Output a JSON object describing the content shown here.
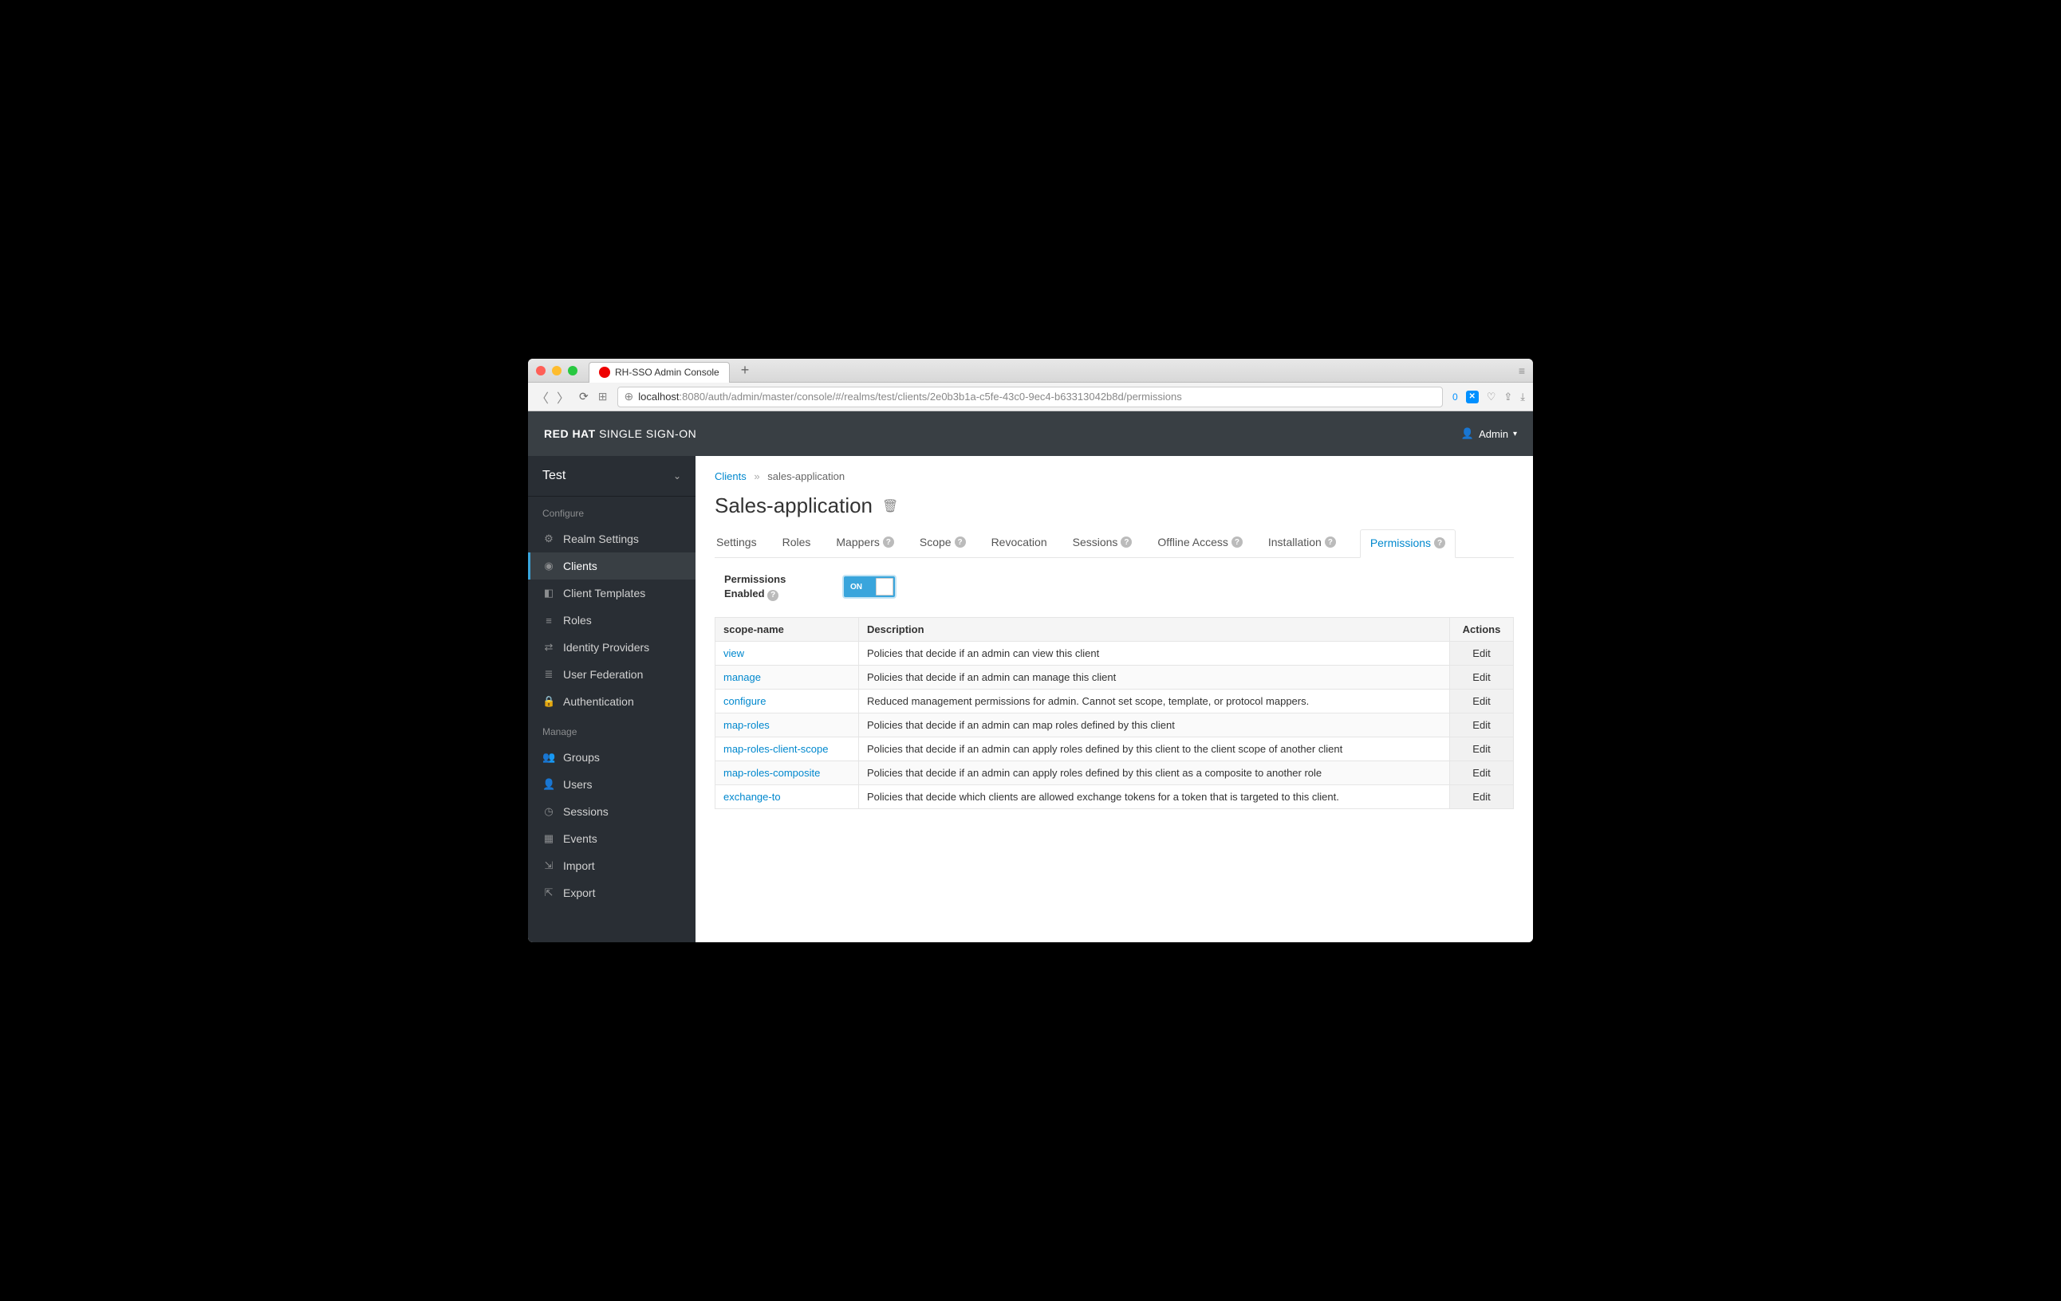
{
  "browser": {
    "tab_title": "RH-SSO Admin Console",
    "url_host": "localhost",
    "url_rest": ":8080/auth/admin/master/console/#/realms/test/clients/2e0b3b1a-c5fe-43c0-9ec4-b63313042b8d/permissions",
    "badge": "0"
  },
  "header": {
    "brand_strong": "RED HAT",
    "brand_rest": " SINGLE SIGN-ON",
    "user": "Admin"
  },
  "sidebar": {
    "realm": "Test",
    "section_configure": "Configure",
    "section_manage": "Manage",
    "configure": [
      {
        "label": "Realm Settings",
        "icon": "⚙"
      },
      {
        "label": "Clients",
        "icon": "◉"
      },
      {
        "label": "Client Templates",
        "icon": "◧"
      },
      {
        "label": "Roles",
        "icon": "≡"
      },
      {
        "label": "Identity Providers",
        "icon": "⇄"
      },
      {
        "label": "User Federation",
        "icon": "≣"
      },
      {
        "label": "Authentication",
        "icon": "🔒"
      }
    ],
    "manage": [
      {
        "label": "Groups",
        "icon": "👥"
      },
      {
        "label": "Users",
        "icon": "👤"
      },
      {
        "label": "Sessions",
        "icon": "◷"
      },
      {
        "label": "Events",
        "icon": "▦"
      },
      {
        "label": "Import",
        "icon": "⇲"
      },
      {
        "label": "Export",
        "icon": "⇱"
      }
    ]
  },
  "breadcrumb": {
    "root": "Clients",
    "current": "sales-application"
  },
  "page": {
    "title": "Sales-application",
    "tabs": [
      "Settings",
      "Roles",
      "Mappers",
      "Scope",
      "Revocation",
      "Sessions",
      "Offline Access",
      "Installation",
      "Permissions"
    ],
    "tabs_help": {
      "Mappers": true,
      "Scope": true,
      "Sessions": true,
      "Offline Access": true,
      "Installation": true,
      "Permissions": true
    },
    "active_tab": "Permissions",
    "perm_enabled_label": "Permissions Enabled",
    "toggle_state": "ON"
  },
  "table": {
    "headers": {
      "scope": "scope-name",
      "desc": "Description",
      "actions": "Actions"
    },
    "edit_label": "Edit",
    "rows": [
      {
        "scope": "view",
        "desc": "Policies that decide if an admin can view this client"
      },
      {
        "scope": "manage",
        "desc": "Policies that decide if an admin can manage this client"
      },
      {
        "scope": "configure",
        "desc": "Reduced management permissions for admin. Cannot set scope, template, or protocol mappers."
      },
      {
        "scope": "map-roles",
        "desc": "Policies that decide if an admin can map roles defined by this client"
      },
      {
        "scope": "map-roles-client-scope",
        "desc": "Policies that decide if an admin can apply roles defined by this client to the client scope of another client"
      },
      {
        "scope": "map-roles-composite",
        "desc": "Policies that decide if an admin can apply roles defined by this client as a composite to another role"
      },
      {
        "scope": "exchange-to",
        "desc": "Policies that decide which clients are allowed exchange tokens for a token that is targeted to this client."
      }
    ]
  }
}
